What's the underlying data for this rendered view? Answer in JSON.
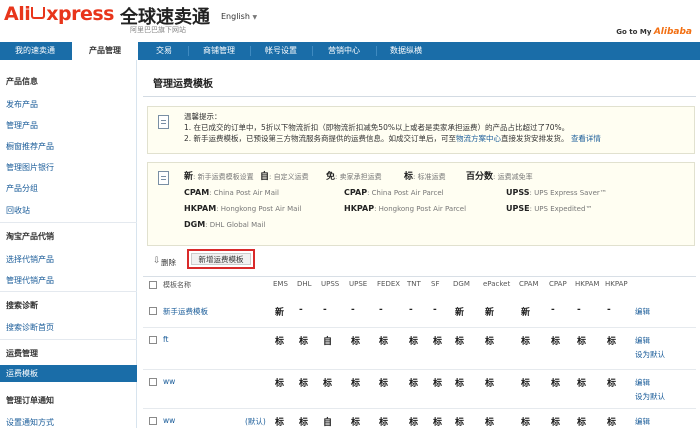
{
  "header": {
    "logo_text": "Ali",
    "logo_text2": "xpress",
    "logo_cn": "全球速卖通",
    "logo_sub": "阿里巴巴旗下网站",
    "language": "English",
    "goto_label": "Go to My",
    "goto_brand": "Alibaba"
  },
  "nav": {
    "tabs": [
      "我的速卖通",
      "产品管理",
      "交易",
      "商铺管理",
      "帐号设置",
      "营销中心",
      "数据纵横"
    ]
  },
  "sidebar": {
    "sections": [
      {
        "title": "产品信息",
        "items": [
          "发布产品",
          "管理产品",
          "橱窗推荐产品",
          "管理图片银行",
          "产品分组",
          "回收站"
        ]
      },
      {
        "title": "淘宝产品代销",
        "items": [
          "选择代销产品",
          "管理代销产品"
        ]
      },
      {
        "title": "搜索诊断",
        "items": [
          "搜索诊断首页"
        ]
      },
      {
        "title": "运费管理",
        "items": [
          "运费模板"
        ]
      },
      {
        "title": "管理订单通知",
        "items": [
          "设置通知方式"
        ]
      }
    ]
  },
  "main": {
    "title": "管理运费模板",
    "notice": {
      "line1": "温馨提示：",
      "line2": "1. 在已成交的订单中，5折以下物流折扣（即物流折扣减免50%以上或者是卖家承担运费）的产品占比超过了70%。",
      "line3": "2. 新手运费模板，已预设第三方物流服务商提供的运费信息。如成交订单后，可至",
      "link1": "物流方案中心",
      "line3b": "直接发货安排发货。",
      "link2": "查看详情"
    },
    "legend": {
      "row1": [
        {
          "sym": "新",
          "desc": "新手运费模板设置"
        },
        {
          "sym": "自",
          "desc": "自定义运费"
        },
        {
          "sym": "免",
          "desc": "卖家承担运费"
        },
        {
          "sym": "标",
          "desc": "标准运费"
        },
        {
          "sym": "百分数",
          "desc": "运费减免率"
        }
      ],
      "codes": [
        {
          "code": "CPAM",
          "desc": "China Post Air Mail"
        },
        {
          "code": "CPAP",
          "desc": "China Post Air Parcel"
        },
        {
          "code": "UPSS",
          "desc": "UPS Express Saver™"
        },
        {
          "code": "HKPAM",
          "desc": "Hongkong Post Air Mail"
        },
        {
          "code": "HKPAP",
          "desc": "Hongkong Post Air Parcel"
        },
        {
          "code": "UPSE",
          "desc": "UPS Expedited™"
        },
        {
          "code": "DGM",
          "desc": "DHL Global Mail"
        }
      ]
    },
    "toolbar": {
      "delete_label": "删除",
      "new_label": "新增运费模板"
    },
    "table": {
      "name_header": "模板名称",
      "columns": [
        "EMS",
        "DHL",
        "UPSS",
        "UPSE",
        "FEDEX",
        "TNT",
        "SF",
        "DGM",
        "ePacket",
        "CPAM",
        "CPAP",
        "HKPAM",
        "HKPAP"
      ],
      "rows": [
        {
          "name": "新手运费模板",
          "tag": "",
          "cells": [
            "新",
            "-",
            "-",
            "-",
            "-",
            "-",
            "-",
            "新",
            "新",
            "新",
            "-",
            "-",
            "-"
          ],
          "actions": [
            "编辑"
          ]
        },
        {
          "name": "ft",
          "tag": "",
          "cells": [
            "标",
            "标",
            "自",
            "标",
            "标",
            "标",
            "标",
            "标",
            "标",
            "标",
            "标",
            "标",
            "标"
          ],
          "actions": [
            "编辑",
            "设为默认"
          ]
        },
        {
          "name": "ww",
          "tag": "",
          "cells": [
            "标",
            "标",
            "标",
            "标",
            "标",
            "标",
            "标",
            "标",
            "标",
            "标",
            "标",
            "标",
            "标"
          ],
          "actions": [
            "编辑",
            "设为默认"
          ]
        },
        {
          "name": "ww",
          "tag": "(默认)",
          "cells": [
            "标",
            "标",
            "自",
            "标",
            "标",
            "标",
            "标",
            "标",
            "标",
            "标",
            "标",
            "标",
            "标"
          ],
          "actions": [
            "编辑"
          ]
        }
      ]
    }
  }
}
